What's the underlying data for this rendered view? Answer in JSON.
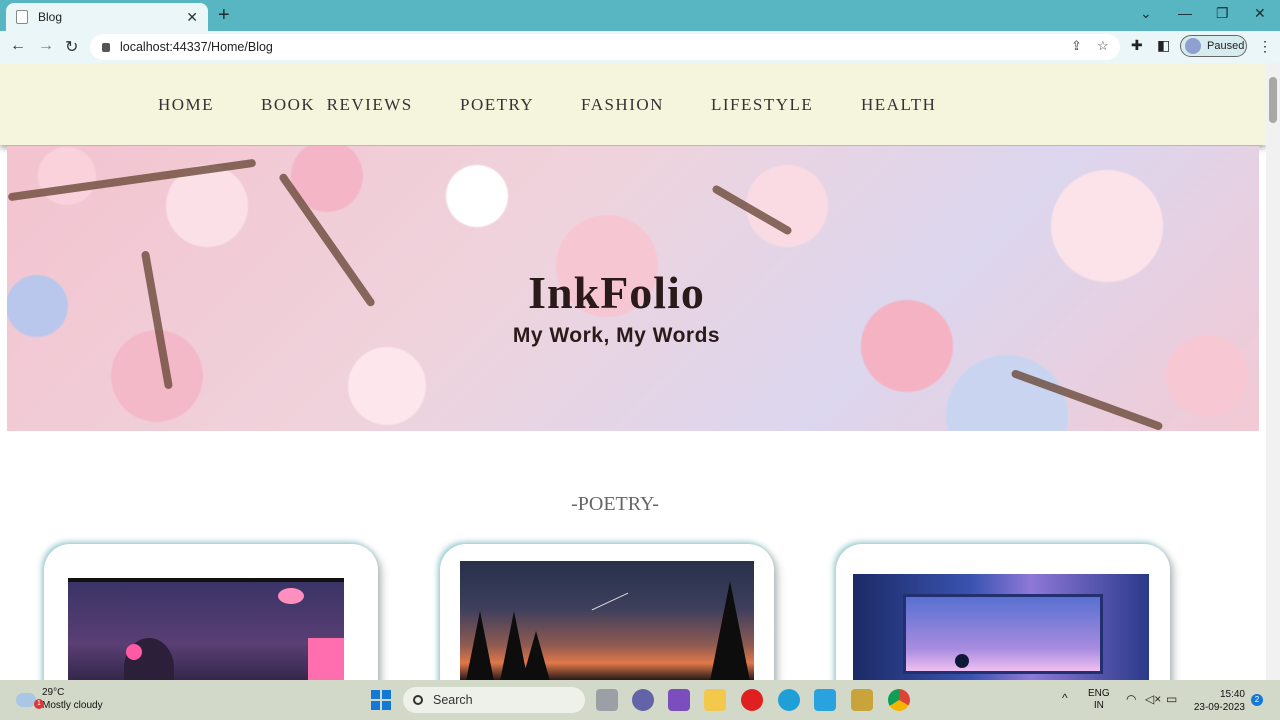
{
  "browser": {
    "tab_title": "Blog",
    "tab_close": "✕",
    "new_tab": "+",
    "url": "localhost:44337/Home/Blog",
    "profile_status": "Paused",
    "window_controls": {
      "minimize": "—",
      "maximize": "❐",
      "close": "✕",
      "tab_search": "⌄"
    },
    "icons": {
      "back": "←",
      "forward": "→",
      "reload": "↻",
      "share": "⇪",
      "star": "☆",
      "extensions": "✚",
      "sidepanel": "◧",
      "menu": "⋮"
    }
  },
  "site": {
    "nav": [
      "HOME",
      "BOOK  REVIEWS",
      "POETRY",
      "FASHION",
      "LIFESTYLE",
      "HEALTH"
    ],
    "hero": {
      "title": "InkFolio",
      "subtitle": "My Work, My Words"
    },
    "section_title": "-POETRY-"
  },
  "taskbar": {
    "weather": {
      "temp": "29°C",
      "condition": "Mostly cloudy",
      "badge": "1"
    },
    "search_label": "Search",
    "language": {
      "line1": "ENG",
      "line2": "IN"
    },
    "time": "15:40",
    "date": "23-09-2023",
    "notification_count": "2",
    "tray_up": "^",
    "apps": [
      "task-view-icon",
      "teams-icon",
      "visual-studio-icon",
      "file-explorer-icon",
      "opera-icon",
      "edge-icon",
      "notepad-icon",
      "sticky-app-icon",
      "chrome-icon"
    ]
  },
  "colors": {
    "titlebar": "#57b6c1",
    "navbar_bg": "#f5f4dc",
    "taskbar": "#d3d9c8",
    "start_blue": "#1479d6"
  }
}
